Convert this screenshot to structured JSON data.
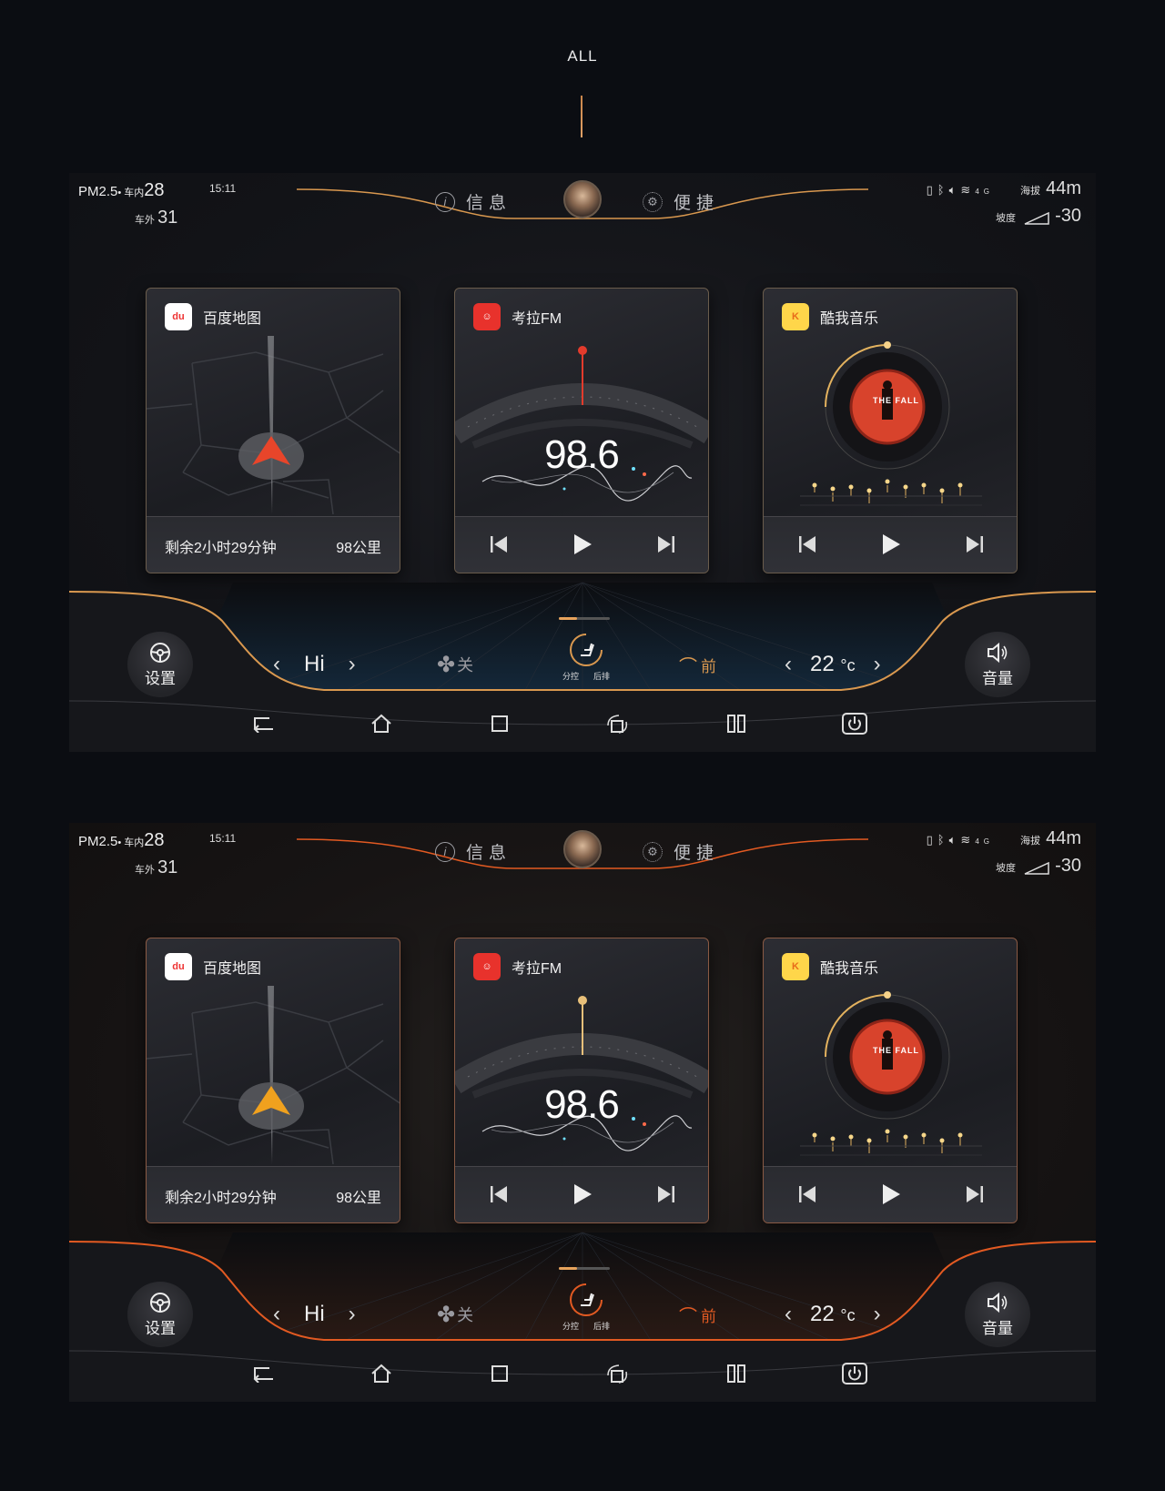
{
  "page": {
    "title": "ALL"
  },
  "screens": [
    {
      "theme": "gold",
      "accent": "#d9984f",
      "status": {
        "pm_label": "PM2.5",
        "inside_label": "车内",
        "inside_value": "28",
        "time": "15:11",
        "outside_label": "车外",
        "outside_value": "31",
        "altitude_label": "海拔",
        "altitude_value": "44m",
        "slope_label": "坡度",
        "slope_value": "-30"
      },
      "top_nav": {
        "info_label": "信息",
        "quick_label": "便捷"
      },
      "cards": {
        "map": {
          "app_name": "百度地图",
          "remaining": "剩余2小时29分钟",
          "distance": "98公里",
          "arrow_color": "#e8452a"
        },
        "radio": {
          "app_name": "考拉FM",
          "frequency": "98.6",
          "needle_color": "#e33b2c"
        },
        "music": {
          "app_name": "酷我音乐",
          "album_text": "THE FALL"
        }
      },
      "climate": {
        "fan_level": "Hi",
        "fan_state": "关",
        "ac_left_label": "分控",
        "ac_right_label": "后排",
        "defrost_label": "前",
        "temperature": "22",
        "temp_unit": "°c"
      },
      "dock": {
        "settings_label": "设置",
        "volume_label": "音量"
      }
    },
    {
      "theme": "orange",
      "accent": "#e25a22",
      "status": {
        "pm_label": "PM2.5",
        "inside_label": "车内",
        "inside_value": "28",
        "time": "15:11",
        "outside_label": "车外",
        "outside_value": "31",
        "altitude_label": "海拔",
        "altitude_value": "44m",
        "slope_label": "坡度",
        "slope_value": "-30"
      },
      "top_nav": {
        "info_label": "信息",
        "quick_label": "便捷"
      },
      "cards": {
        "map": {
          "app_name": "百度地图",
          "remaining": "剩余2小时29分钟",
          "distance": "98公里",
          "arrow_color": "#f0a11e"
        },
        "radio": {
          "app_name": "考拉FM",
          "frequency": "98.6",
          "needle_color": "#e8c07a"
        },
        "music": {
          "app_name": "酷我音乐",
          "album_text": "THE FALL"
        }
      },
      "climate": {
        "fan_level": "Hi",
        "fan_state": "关",
        "ac_left_label": "分控",
        "ac_right_label": "后排",
        "defrost_label": "前",
        "temperature": "22",
        "temp_unit": "°c"
      },
      "dock": {
        "settings_label": "设置",
        "volume_label": "音量"
      }
    }
  ]
}
